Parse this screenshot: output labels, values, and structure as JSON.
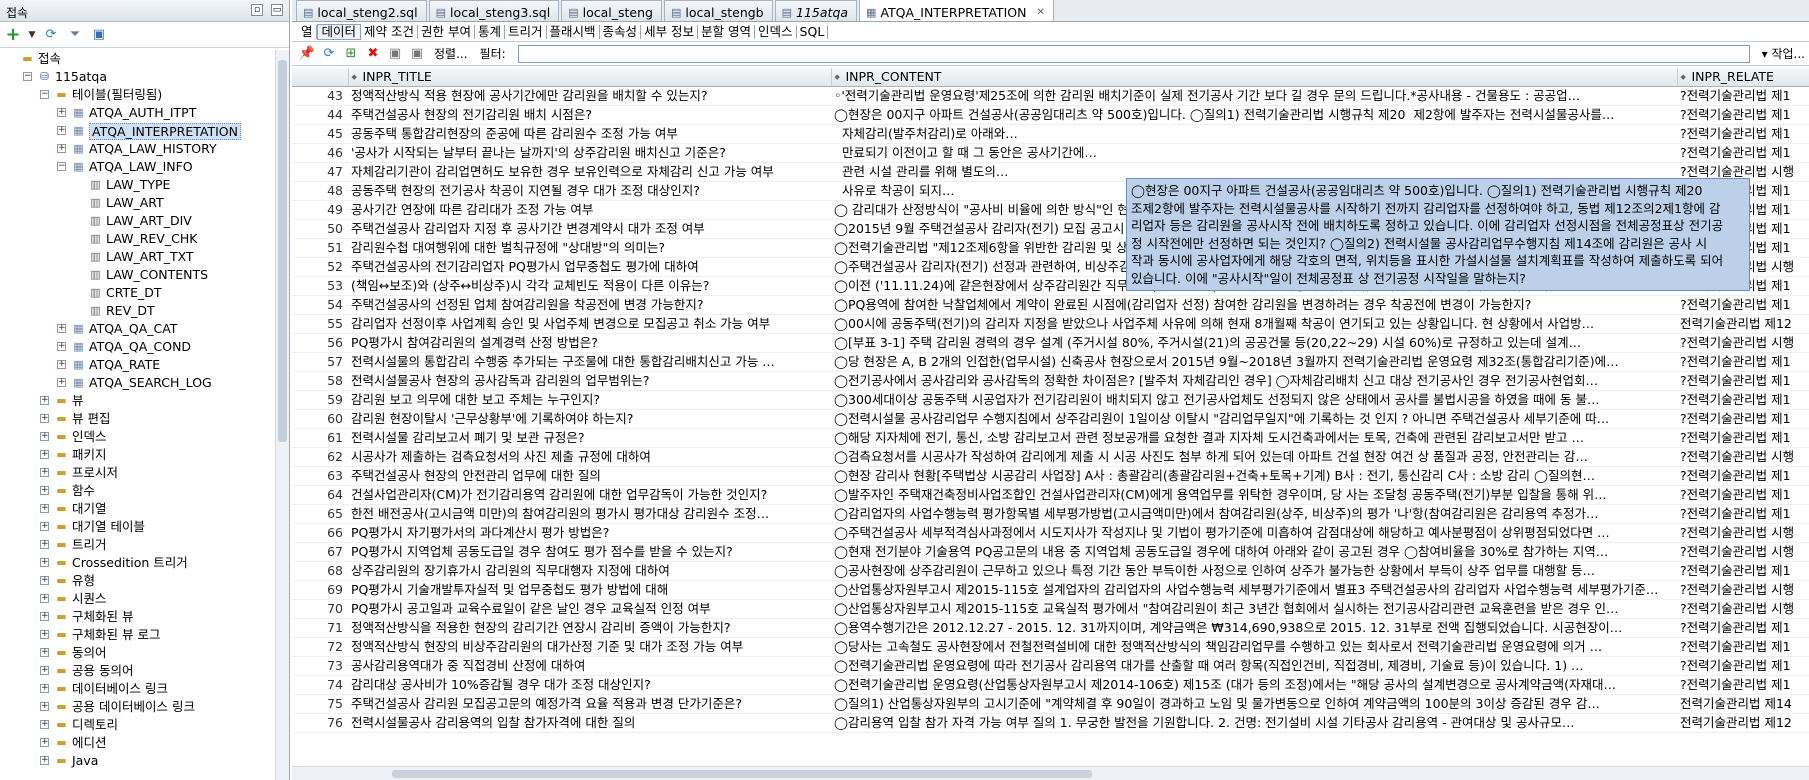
{
  "left_panel": {
    "title": "접속",
    "tree": [
      {
        "depth": 0,
        "label": "접속",
        "icon": "folder-icon",
        "exp": "",
        "sel": false
      },
      {
        "depth": 1,
        "label": "115atqa",
        "icon": "database-icon",
        "exp": "−",
        "sel": false
      },
      {
        "depth": 2,
        "label": "테이블(필터링됨)",
        "icon": "folder-icon",
        "exp": "−",
        "sel": false
      },
      {
        "depth": 3,
        "label": "ATQA_AUTH_ITPT",
        "icon": "table-icon",
        "exp": "+",
        "sel": false
      },
      {
        "depth": 3,
        "label": "ATQA_INTERPRETATION",
        "icon": "table-icon",
        "exp": "+",
        "sel": true
      },
      {
        "depth": 3,
        "label": "ATQA_LAW_HISTORY",
        "icon": "table-icon",
        "exp": "+",
        "sel": false
      },
      {
        "depth": 3,
        "label": "ATQA_LAW_INFO",
        "icon": "table-icon",
        "exp": "−",
        "sel": false
      },
      {
        "depth": 4,
        "label": "LAW_TYPE",
        "icon": "column-icon",
        "exp": "",
        "sel": false
      },
      {
        "depth": 4,
        "label": "LAW_ART",
        "icon": "column-icon",
        "exp": "",
        "sel": false
      },
      {
        "depth": 4,
        "label": "LAW_ART_DIV",
        "icon": "column-icon",
        "exp": "",
        "sel": false
      },
      {
        "depth": 4,
        "label": "LAW_REV_CHK",
        "icon": "column-icon",
        "exp": "",
        "sel": false
      },
      {
        "depth": 4,
        "label": "LAW_ART_TXT",
        "icon": "column-icon",
        "exp": "",
        "sel": false
      },
      {
        "depth": 4,
        "label": "LAW_CONTENTS",
        "icon": "column-icon",
        "exp": "",
        "sel": false
      },
      {
        "depth": 4,
        "label": "CRTE_DT",
        "icon": "column-icon",
        "exp": "",
        "sel": false
      },
      {
        "depth": 4,
        "label": "REV_DT",
        "icon": "column-icon",
        "exp": "",
        "sel": false
      },
      {
        "depth": 3,
        "label": "ATQA_QA_CAT",
        "icon": "table-icon",
        "exp": "+",
        "sel": false
      },
      {
        "depth": 3,
        "label": "ATQA_QA_COND",
        "icon": "table-icon",
        "exp": "+",
        "sel": false
      },
      {
        "depth": 3,
        "label": "ATQA_RATE",
        "icon": "table-icon",
        "exp": "+",
        "sel": false
      },
      {
        "depth": 3,
        "label": "ATQA_SEARCH_LOG",
        "icon": "table-icon",
        "exp": "+",
        "sel": false
      },
      {
        "depth": 2,
        "label": "뷰",
        "icon": "folder-icon",
        "exp": "+",
        "sel": false
      },
      {
        "depth": 2,
        "label": "뷰 편집",
        "icon": "folder-icon",
        "exp": "+",
        "sel": false
      },
      {
        "depth": 2,
        "label": "인덱스",
        "icon": "folder-icon",
        "exp": "+",
        "sel": false
      },
      {
        "depth": 2,
        "label": "패키지",
        "icon": "folder-icon",
        "exp": "+",
        "sel": false
      },
      {
        "depth": 2,
        "label": "프로시저",
        "icon": "folder-icon",
        "exp": "+",
        "sel": false
      },
      {
        "depth": 2,
        "label": "함수",
        "icon": "folder-icon",
        "exp": "+",
        "sel": false
      },
      {
        "depth": 2,
        "label": "대기열",
        "icon": "folder-icon",
        "exp": "+",
        "sel": false
      },
      {
        "depth": 2,
        "label": "대기열 테이블",
        "icon": "folder-icon",
        "exp": "+",
        "sel": false
      },
      {
        "depth": 2,
        "label": "트리거",
        "icon": "folder-icon",
        "exp": "+",
        "sel": false
      },
      {
        "depth": 2,
        "label": "Crossedition 트리거",
        "icon": "folder-icon",
        "exp": "+",
        "sel": false
      },
      {
        "depth": 2,
        "label": "유형",
        "icon": "folder-icon",
        "exp": "+",
        "sel": false
      },
      {
        "depth": 2,
        "label": "시퀀스",
        "icon": "folder-icon",
        "exp": "+",
        "sel": false
      },
      {
        "depth": 2,
        "label": "구체화된 뷰",
        "icon": "folder-icon",
        "exp": "+",
        "sel": false
      },
      {
        "depth": 2,
        "label": "구체화된 뷰 로그",
        "icon": "folder-icon",
        "exp": "+",
        "sel": false
      },
      {
        "depth": 2,
        "label": "동의어",
        "icon": "folder-icon",
        "exp": "+",
        "sel": false
      },
      {
        "depth": 2,
        "label": "공용 동의어",
        "icon": "folder-icon",
        "exp": "+",
        "sel": false
      },
      {
        "depth": 2,
        "label": "데이터베이스 링크",
        "icon": "folder-icon",
        "exp": "+",
        "sel": false
      },
      {
        "depth": 2,
        "label": "공용 데이터베이스 링크",
        "icon": "folder-icon",
        "exp": "+",
        "sel": false
      },
      {
        "depth": 2,
        "label": "디렉토리",
        "icon": "folder-icon",
        "exp": "+",
        "sel": false
      },
      {
        "depth": 2,
        "label": "에디션",
        "icon": "folder-icon",
        "exp": "+",
        "sel": false
      },
      {
        "depth": 2,
        "label": "Java",
        "icon": "folder-icon",
        "exp": "+",
        "sel": false
      }
    ]
  },
  "tabs": [
    {
      "label": "local_steng2.sql",
      "active": false
    },
    {
      "label": "local_steng3.sql",
      "active": false
    },
    {
      "label": "local_steng",
      "active": false
    },
    {
      "label": "local_stengb",
      "active": false
    },
    {
      "label": "115atqa",
      "active": false
    },
    {
      "label": "ATQA_INTERPRETATION",
      "active": true
    }
  ],
  "subtabs": [
    "열",
    "데이터",
    "제약 조건",
    "권한 부여",
    "통계",
    "트리거",
    "플래시백",
    "종속성",
    "세부 정보",
    "분할 영역",
    "인덱스",
    "SQL"
  ],
  "active_subtab": "데이터",
  "toolbar": {
    "sort_label": "정렬...",
    "filter_label": "필터:",
    "actions_label": "▾ 작업..."
  },
  "grid": {
    "columns": [
      "INPR_TITLE",
      "INPR_CONTENT",
      "INPR_RELATE"
    ],
    "rows": [
      [
        "43",
        "정액적산방식 적용 현장에 공사기간에만 감리원을 배치할 수 있는지?",
        "◦'전력기술관리법 운영요령'제25조에 의한 감리원 배치기준이 실제 전기공사 기간 보다 길 경우 문의 드립니다.*공사내용 - 건물용도 : 공공업…",
        "?전력기술관리법 제1"
      ],
      [
        "44",
        "주택건설공사 현장의 전기감리원 배치 시점은?",
        "◯현장은 00지구 아파트 건설공사(공공임대리츠 약 500호)입니다. ◯질의1) 전력기술관리법 시행규칙 제20",
        "제2항에 발주자는 전력시설물공사를…",
        "?전력기술관리법 제1"
      ],
      [
        "45",
        "공동주택 통합감리현장의 준공에 따른 감리원수 조정 가능 여부",
        "",
        "자체감리(발주처감리)로 아래와…",
        "?전력기술관리법 제1"
      ],
      [
        "46",
        "'공사가 시작되는 날부터 끝나는 날까지'의 상주감리원 배치신고 기준은?",
        "",
        "만료되기 이전이고 할 때 그 동안은 공사기간에…",
        "?전력기술관리법 제1"
      ],
      [
        "47",
        "자체감리기관이 감리업면허도 보유한 경우 보유인력으로 자체감리 신고 가능 여부",
        "",
        "관련 시설 관리를 위해 별도의…",
        "?전력기술관리법 시행"
      ],
      [
        "48",
        "공동주택 현장의 전기공사 착공이 지연될 경우 대가 조정 대상인지?",
        "",
        "사유로 착공이 되지…",
        "?전력기술관리법 제1"
      ],
      [
        "49",
        "공사기간 연장에 따른 감리대가 조정 가능 여부",
        "◯ 감리대가 산정방식이 \"공사비 비율에 의한 방식\"인 현장에서 전기공사비 증가 및 공사기간의 변경(공사감리기간 연장)이 있는 경우 공사감리배…",
        "?전력기술관리법 제1"
      ],
      [
        "50",
        "주택건설공사 감리업자 지정 후 공사기간 변경계약시 대가 조정 여부",
        "◯2015년 9월 주택건설공사 감리자(전기) 모집 공고시 공사감리기간이 23개월(2016.4.1 - 2018.2.28)로 예정되어, 2015년 10월 감리자 계약…",
        "?전력기술관리법 제1"
      ],
      [
        "51",
        "감리원수첩 대여행위에 대한 벌칙규정에 \"상대방\"의 의미는?",
        "◯전력기술관리법 \"제12조제6항을 위반한 감리원 및 상대방\"은 동법 제29조(벌칙)에 의거 1년이하의 징역이나 천만원이하의 벌금에 처하게 되어…",
        "?전력기술관리법 제1"
      ],
      [
        "52",
        "주택건설공사의 전기감리업자 PQ평가시 업무중첩도 평가에 대하여",
        "◯주택건설공사 감리자(전기) 선정과 관련하여, 비상주감리원 평가시 감리원 업무중첩도·교체빈도 부실벌점확인서에는 업무중첩도(진행중인용역)가 …",
        "?전력기술관리법 시행"
      ],
      [
        "53",
        "(책임↔보조)와 (상주↔비상주)시 각각 교체빈도 적용이 다른 이유는?",
        "◯이전 ('11.11.24)에 같은현장에서 상주감리원간 직무변경(책임↔보조)시 교체빈도 적용에 대하여 유권해석 질의를 한적이 있는데 그때는 \"교…",
        "?전력기술관리법 제1"
      ],
      [
        "54",
        "주택건설공사의 선정된 업체 참여감리원을 착공전에 변경 가능한지?",
        "◯PQ용역에 참여한 낙찰업체에서 계약이 완료된 시점에(감리업자 선정) 참여한 감리원을 변경하려는 경우 착공전에 변경이 가능한지?",
        "?전력기술관리법 제1"
      ],
      [
        "55",
        "감리업자 선정이후 사업계획 승인 및 사업주체 변경으로 모집공고 취소 가능 여부",
        "◯00시에 공동주택(전기)의 감리자 지정을 받았으나 사업주체 사유에 의해 현재 8개월째 착공이 연기되고 있는 상황입니다. 현 상황에서 사업방…",
        "전력기술관리법 제12"
      ],
      [
        "56",
        "PQ평가시 참여감리원의 설계경력 산정 방법은?",
        "◯[부표 3-1] 주택 감리원 경력의 경우 설계 (주거시설 80%, 주거시설(21)의 공공건물 등(20,22~29) 시설 60%)로 규정하고 있는데 설계…",
        "?전력기술관리법 시행"
      ],
      [
        "57",
        "전력시설물의 통합감리 수행중 추가되는 구조물에 대한 통합감리배치신고 가능 …",
        "◯당 현장은 A, B 2개의 인접한(업무시설) 신축공사 현장으로서 2015년 9월~2018년 3월까지 전력기술관리법 운영요령 제32조(통합감리기준)에…",
        "?전력기술관리법 제1"
      ],
      [
        "58",
        "전력시설물공사 현장의 공사감독과 감리원의 업무범위는?",
        "◯전기공사에서 공사감리와 공사감독의 정확한 차이점은? [발주처 자체감리인 경우] ◯자체감리배치 신고 대상 전기공사인 경우 전기공사현업회…",
        "?전력기술관리법 제1"
      ],
      [
        "59",
        "감리원 보고 의무에 대한 보고 주체는 누구인지?",
        "◯300세대이상 공동주택 시공업자가 전기감리원이 배치되지 않고 전기공사업체도 선정되지 않은 상태에서 공사를 불법시공을 하였을 때에 동 불…",
        "?전력기술관리법 제1"
      ],
      [
        "60",
        "감리원 현장이탈시 '근무상황부'에 기록하여야 하는지?",
        "◯전력시설물 공사감리업무 수행지침에서 상주감리원이 1일이상 이탈시 \"감리업무일지\"에 기록하는 것 인지 ? 아니면 주택건설공사 세부기준에 따…",
        "?전력기술관리법 제1"
      ],
      [
        "61",
        "전력시설물 감리보고서 폐기 및 보관 규정은?",
        "◯해당 지자체에 전기, 통신, 소방 감리보고서 관련 정보공개를 요청한 결과 지자체 도시건축과에서는 토목, 건축에 관련된 감리보고서만 받고 …",
        "?전력기술관리법 제1"
      ],
      [
        "62",
        "시공사가 제출하는 검측요청서의 사진 제출 규정에 대하여",
        "◯검측요청서를 시공사가 작성하여 감리에게 제출 시 시공 사진도 첨부 하게 되어 있는데 아파트 건설 현장 여건 상 품질과 공정, 안전관리는 감…",
        "?전력기술관리법 시행"
      ],
      [
        "63",
        "주택건설공사 현장의 안전관리 업무에 대한 질의",
        "◯현장 감리사 현황[주택법상 시공감리 사업장] A사 : 총괄감리(총괄감리원+건축+토목+기계) B사 : 전기, 통신감리 C사 : 소방 감리 ◯질의현…",
        "?전력기술관리법 제1"
      ],
      [
        "64",
        "건설사업관리자(CM)가 전기감리용역 감리원에 대한 업무감독이 가능한 것인지?",
        "◯발주자인 주택재건축정비사업조합인 건설사업관리자(CM)에게 용역업무를 위탁한 경우이며, 당 사는 조달청 공동주택(전기)부분 입찰을 통해 위…",
        "?전력기술관리법 제1"
      ],
      [
        "65",
        "한전 배전공사(고시금액 미만)의 참여감리원의 평가시 평가대상 감리원수 조정…",
        "◯감리업자의 사업수행능력 평가항목별 세부평가방법(고시금액미만)에서 참여감리원(상주, 비상주)의 평가 '나'항(참여감리원은 감리용역 추정가…",
        "?전력기술관리법 제1"
      ],
      [
        "66",
        "PQ평가시 자기평가서의 과다계산시 평가 방법은?",
        "◯주택건설공사 세부적격심사과정에서 시도지사가 작성지나 및 기법이 평가기준에 미흡하여 감점대상에 해당하고 예사분평점이 상위평점되었다면 …",
        "?전력기술관리법 시행"
      ],
      [
        "67",
        "PQ평가시 지역업체 공동도급일 경우 참여도 평가 점수를 받을 수 있는지?",
        "◯현재 전기분야 기술용역 PQ공고문의 내용 중 지역업체 공동도급일 경우에 대하여 아래와 같이 공고된 경우 ◯참여비율을 30%로 참가하는 지역…",
        "?전력기술관리법 시행"
      ],
      [
        "68",
        "상주감리원의 장기휴가시 감리원의 직무대행자 지정에 대하여",
        "◯공사현장에 상주감리원이 근무하고 있으나 특정 기간 동안 부득이한 사정으로 인하여 상주가 불가능한 상황에서 부득이 상주 업무를 대행할 등…",
        "?전력기술관리법 제1"
      ],
      [
        "69",
        "PQ평가시 기술개발투자실적 및 업무중첩도 평가 방법에 대해",
        "◯산업통상자원부고시 제2015-115호 설계업자의 감리업자의 사업수행능력 세부평가기준에서 별표3 주택건설공사의 감리업자 사업수행능력 세부평가기준…",
        "?전력기술관리법 시행"
      ],
      [
        "70",
        "PQ평가시 공고일과 교육수료일이 같은 날인 경우 교육실적 인정 여부",
        "◯산업통상자원부고시 제2015-115호 교육실적 평가에서 \"참여감리원이 최근 3년간 협회에서 실시하는 전기공사감리관련 교육훈련을 받은 경우 인…",
        "?전력기술관리법 시행"
      ],
      [
        "71",
        "정액적산방식을 적용한 현장의 감리기간 연장시 감리비 증액이 가능한지?",
        "◯용역수행기간은 2012.12.27 - 2015. 12. 31까지이며, 계약금액은 ₩314,690,938으로 2015. 12. 31부로 전액 집행되었습니다. 시공현장이…",
        "?전력기술관리법 제1"
      ],
      [
        "72",
        "정액적산방식 현장의 비상주감리원의 대가산정 기준 및 대가 조정 가능 여부",
        "◯당사는 고속철도 공사현장에서 전철전력설비에 대한 정액적산방식의 책임감리업무를 수행하고 있는 회사로서 전력기술관리법 운영요령에 의거 …",
        "?전력기술관리법 제1"
      ],
      [
        "73",
        "공사감리용역대가 중 직접경비 산정에 대하여",
        "◯전력기술관리법 운영요령에 따라 전기공사 감리용역 대가를 산출할 때 여러 항목(직접인건비, 직접경비, 제경비, 기술료 등)이 있습니다. 1) …",
        "?전력기술관리법 제1"
      ],
      [
        "74",
        "감리대상 공사비가 10%증감될 경우 대가 조정 대상인지?",
        "◯전력기술관리법 운영요령(산업통상자원부고시 제2014-106호) 제15조 (대가 등의 조정)에서는 \"해당 공사의 설계변경으로 공사계약금액(자재대…",
        "?전력기술관리법 제1"
      ],
      [
        "75",
        "주택건설공사 감리원 모집공고문의 예정가격 요율 적용과 변경 단가기준은?",
        "◯질의1) 산업통상자원부의 고시기준에 \"계약체결 후 90일이 경과하고 노임 및 물가변동으로 인하여 계약금액의 100분의 3이상 증감된 경우 감…",
        "전력기술관리법 제14"
      ],
      [
        "76",
        "전력시설물공사 감리용역의 입찰 참가자격에 대한 질의",
        "◯감리용역 입찰 참가 자격 가능 여부 질의 1. 무궁한 발전을 기원합니다. 2. 건명: 전기설비 시설 기타공사 감리용역 - 관여대상 및 공사규모…",
        "전력기술관리법 제12"
      ]
    ]
  },
  "tooltip": "◯현장은 00지구 아파트 건설공사(공공임대리츠 약 500호)입니다. ◯질의1) 전력기술관리법 시행규칙 제20\n조제2항에 발주자는 전력시설물공사를 시작하기 전까지 감리업자를 선정하여야 하고, 동법 제12조의2제1항에 감\n리업자 등은 감리원을 공사시작 전에 배치하도록 정하고 있습니다. 이에 감리업자 선정시점을 전체공정표상 전기공\n정 시작전에만 선정하면 되는 것인지? ◯질의2) 전력시설물 공사감리업무수행지침 제14조에 감리원은 공사 시\n작과 동시에 공사업자에게 해당 각호의 면적, 위치등을 표시한 가설시설물 설치계획표를 작성하여 제출하도록 되어\n있습니다. 이에 \"공사시작\"일이 전체공정표 상 전기공정 시작일을 말하는지?"
}
